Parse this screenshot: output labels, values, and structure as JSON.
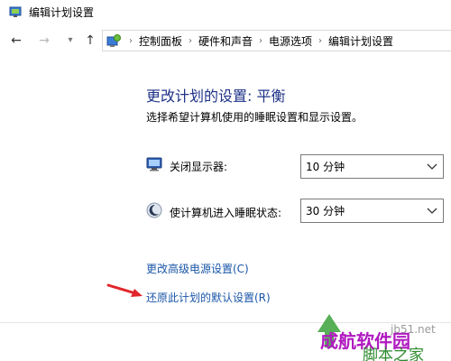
{
  "window": {
    "title": "编辑计划设置",
    "icon": "power-options-icon"
  },
  "nav": {
    "back_icon": "arrow-left-icon",
    "forward_icon": "arrow-right-icon",
    "recent_icon": "chevron-down-icon",
    "up_icon": "arrow-up-icon",
    "breadcrumbs": [
      "控制面板",
      "硬件和声音",
      "电源选项",
      "编辑计划设置"
    ],
    "separator": "›"
  },
  "main": {
    "header": "更改计划的设置: 平衡",
    "description": "选择希望计算机使用的睡眠设置和显示设置。",
    "settings": [
      {
        "label": "关闭显示器:",
        "value": "10 分钟",
        "icon": "monitor-icon"
      },
      {
        "label": "使计算机进入睡眠状态:",
        "value": "30 分钟",
        "icon": "moon-icon"
      }
    ],
    "links": {
      "advanced": "更改高级电源设置(C)",
      "restore": "还原此计划的默认设置(R)"
    }
  },
  "annotation": {
    "arrow_color": "#e0262b"
  },
  "watermark": {
    "main": "成航软件园",
    "sub": "脚本之家",
    "url": "jb51.net"
  },
  "colors": {
    "header": "#1e3287",
    "link": "#1a56a8"
  }
}
